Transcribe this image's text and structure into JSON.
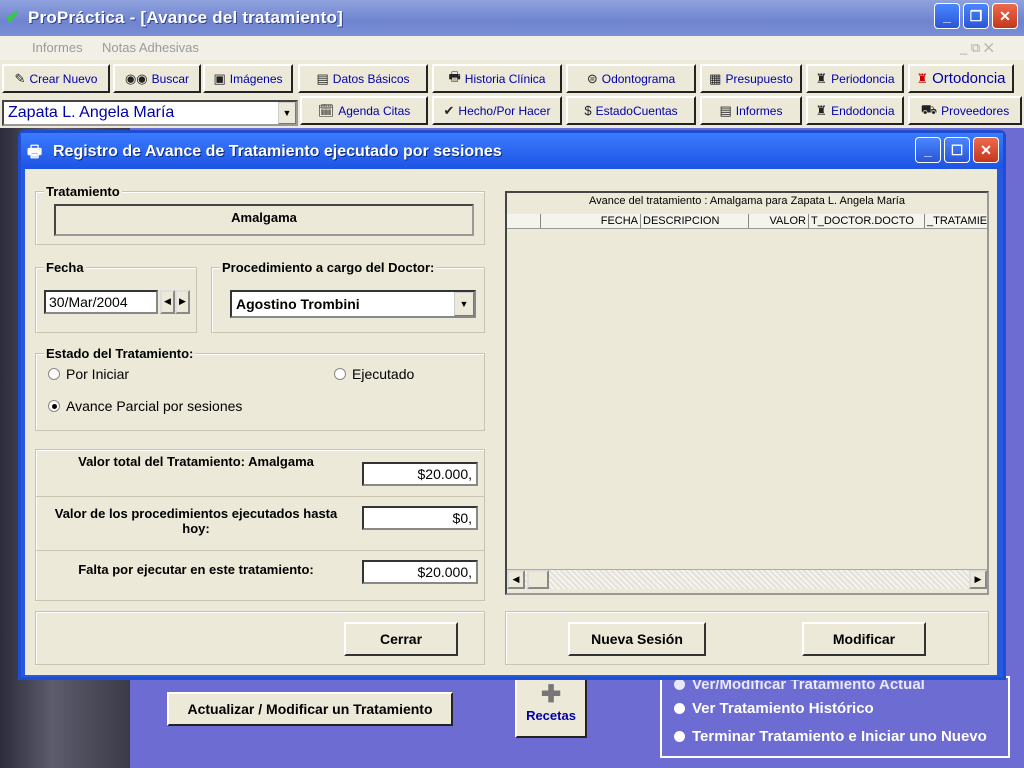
{
  "app": {
    "title": "ProPráctica - [Avance del tratamiento]",
    "menu": [
      "Informes",
      "Notas Adhesivas"
    ]
  },
  "toolbar": {
    "crear_nuevo": "Crear Nuevo",
    "buscar": "Buscar",
    "imagenes": "Imágenes",
    "datos_basicos": "Datos Básicos",
    "historia_clinica": "Historia Clínica",
    "odontograma": "Odontograma",
    "presupuesto": "Presupuesto",
    "periodoncia": "Periodoncia",
    "ortodoncia": "Ortodoncia",
    "agenda_citas": "Agenda Citas",
    "hecho_por_hacer": "Hecho/Por Hacer",
    "estado_cuentas": "EstadoCuentas",
    "informes": "Informes",
    "endodoncia": "Endodoncia",
    "proveedores": "Proveedores",
    "patient": "Zapata L. Angela María"
  },
  "background": {
    "actualizar_button": "Actualizar / Modificar un Tratamiento",
    "recetas": "Recetas",
    "options": [
      "Ver/Modificar Tratamiento Actual",
      "Ver Tratamiento Histórico",
      "Terminar Tratamiento e Iniciar uno Nuevo"
    ]
  },
  "dialog": {
    "title": "Registro de Avance de Tratamiento ejecutado por sesiones",
    "tratamiento_label": "Tratamiento",
    "tratamiento_value": "Amalgama",
    "fecha_label": "Fecha",
    "fecha_value": "30/Mar/2004",
    "procedimiento_label": "Procedimiento a cargo del Doctor:",
    "doctor_value": "Agostino Trombini",
    "estado_label": "Estado del Tratamiento:",
    "radio_por_iniciar": "Por Iniciar",
    "radio_ejecutado": "Ejecutado",
    "radio_avance_parcial": "Avance Parcial por sesiones",
    "selected_estado": "Avance Parcial por sesiones",
    "valor_total_label": "Valor total  del Tratamiento:  Amalgama",
    "valor_total_value": "$20.000,",
    "valor_ejecutados_label": "Valor de los procedimientos ejecutados hasta hoy:",
    "valor_ejecutados_value": "$0,",
    "falta_label": "Falta por ejecutar en este tratamiento:",
    "falta_value": "$20.000,",
    "cerrar": "Cerrar",
    "nueva_sesion": "Nueva Sesión",
    "modificar": "Modificar"
  },
  "grid": {
    "caption": "Avance del tratamiento : Amalgama para Zapata L. Angela María",
    "columns": [
      "FECHA",
      "DESCRIPCION",
      "VALOR",
      "T_DOCTOR.DOCTO",
      "_TRATAMIE"
    ],
    "rows": []
  }
}
